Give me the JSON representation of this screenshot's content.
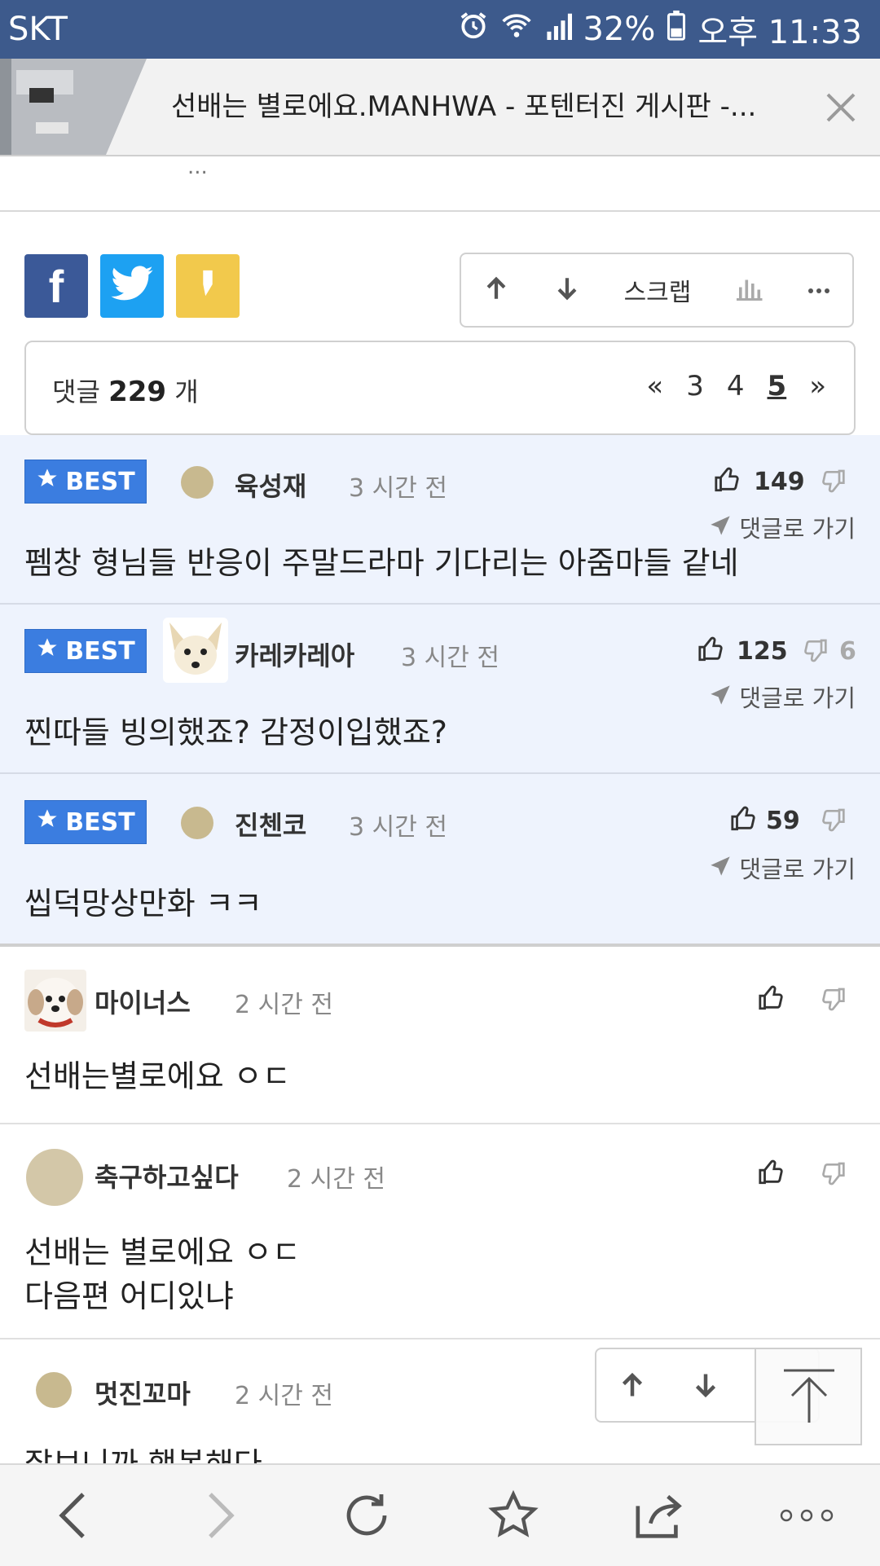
{
  "status": {
    "carrier": "SKT",
    "battery": "32%",
    "time": "오후 11:33"
  },
  "tab": {
    "title": "선배는 별로에요.MANHWA - 포텐터진 게시판 -...",
    "ellipsis": "..."
  },
  "toolbar": {
    "scrap_label": "스크랩"
  },
  "comments_header": {
    "prefix": "댓글",
    "count": "229",
    "suffix": "개",
    "pages": [
      "«",
      "3",
      "4",
      "5",
      "»"
    ]
  },
  "best_badge": "BEST",
  "goto_label": "댓글로 가기",
  "best_comments": [
    {
      "author": "육성재",
      "time": "3 시간 전",
      "likes": "149",
      "dislikes": "",
      "text": "펨창 형님들 반응이 주말드라마 기다리는 아줌마들 같네"
    },
    {
      "author": "카레카레아",
      "time": "3 시간 전",
      "likes": "125",
      "dislikes": "6",
      "text": "찐따들 빙의했죠? 감정이입했죠?"
    },
    {
      "author": "진첸코",
      "time": "3 시간 전",
      "likes": "59",
      "dislikes": "",
      "text": "씹덕망상만화 ㅋㅋ"
    }
  ],
  "comments": [
    {
      "author": "마이너스",
      "time": "2 시간 전",
      "text": "선배는별로에요 ㅇㄷ"
    },
    {
      "author": "축구하고싶다",
      "time": "2 시간 전",
      "text_line1": "선배는 별로에요 ㅇㄷ",
      "text_line2": "다음편 어디있냐"
    },
    {
      "author": "멋진꼬마",
      "time": "2 시간 전",
      "text": "잘보니까 행복해다"
    }
  ],
  "colors": {
    "status_bar": "#3d5a8c",
    "best_bg": "#eef3fd",
    "best_badge": "#3b7de0",
    "facebook": "#3b5998",
    "twitter": "#1da1f2",
    "kakao": "#f2c94c"
  },
  "icons": [
    "alarm-icon",
    "wifi-icon",
    "signal-icon",
    "battery-icon",
    "close-icon",
    "facebook-icon",
    "twitter-icon",
    "kakaostory-icon",
    "arrow-up-icon",
    "arrow-down-icon",
    "chart-icon",
    "more-icon",
    "star-icon",
    "thumbs-up-icon",
    "thumbs-down-icon",
    "send-icon",
    "back-icon",
    "forward-icon",
    "refresh-icon",
    "bookmark-icon",
    "share-icon",
    "menu-dots-icon",
    "scroll-top-icon"
  ]
}
